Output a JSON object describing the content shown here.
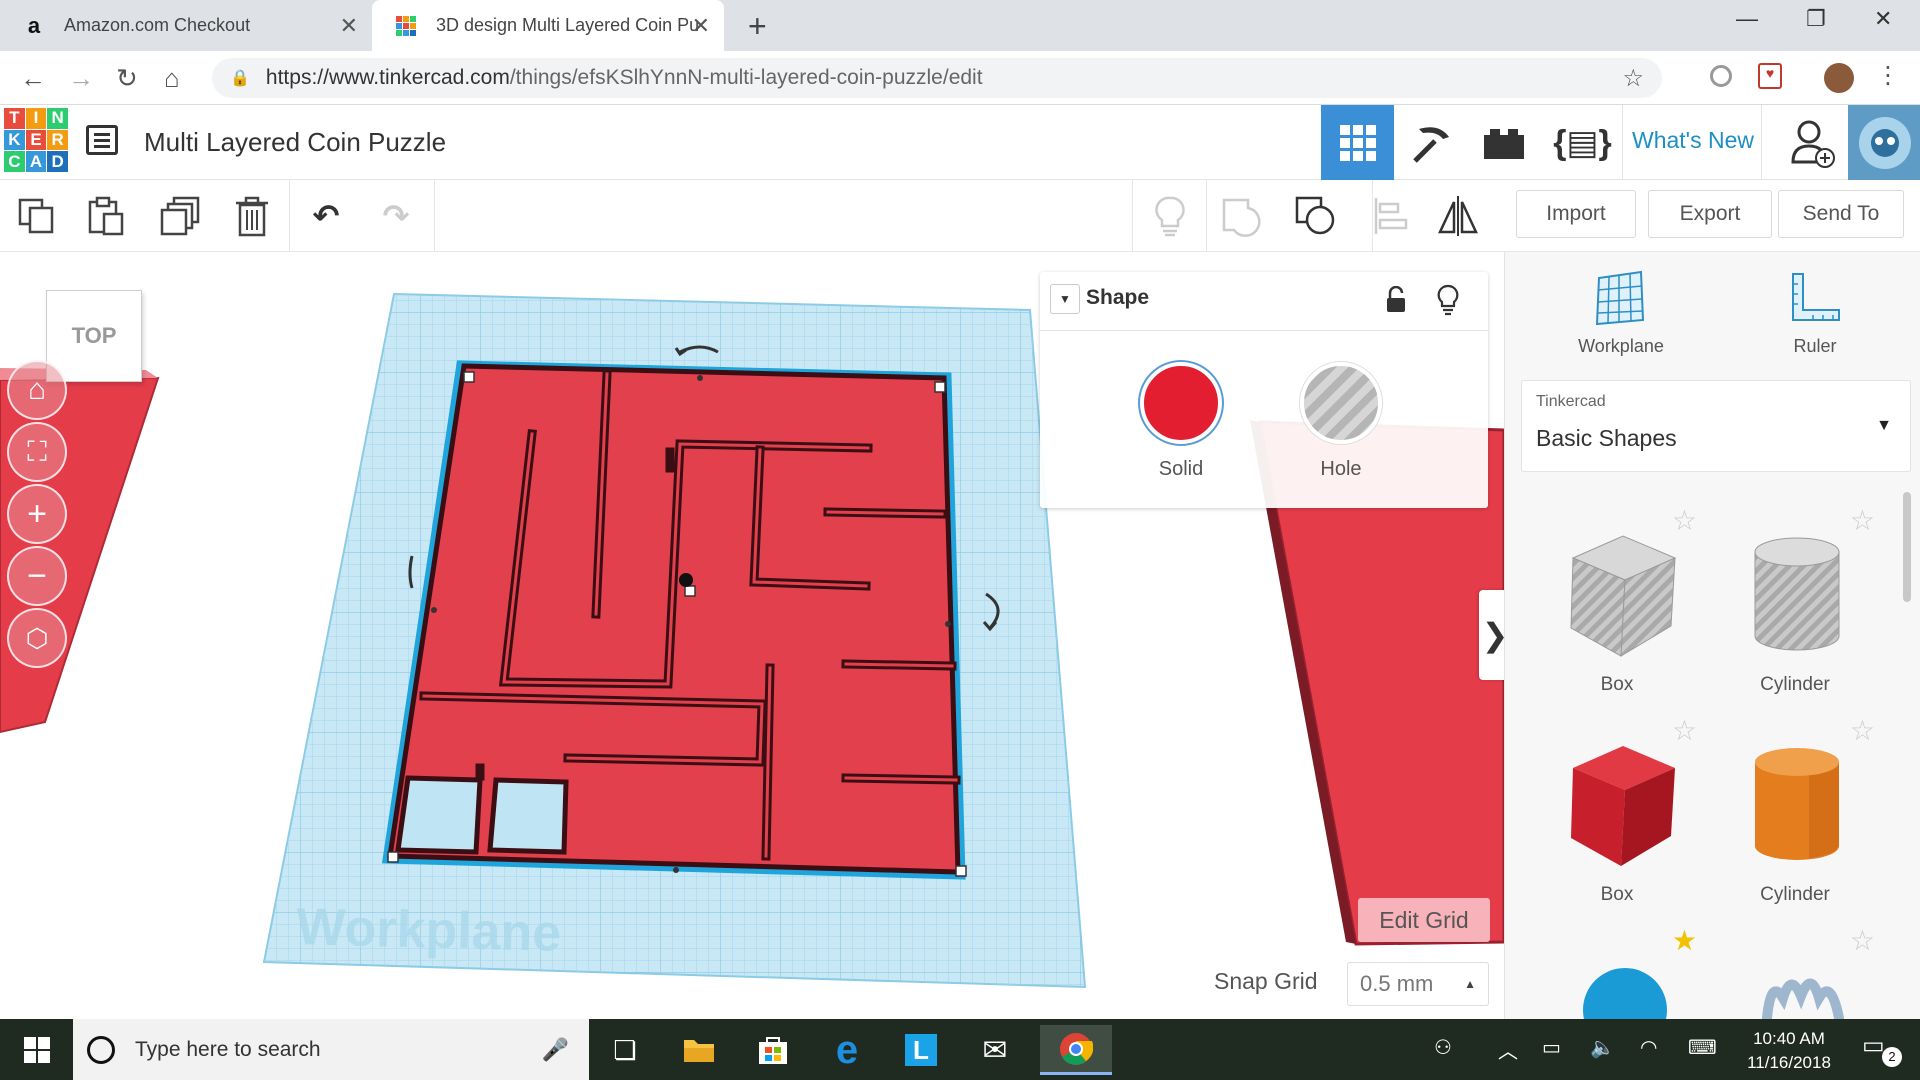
{
  "browser": {
    "tabs": [
      {
        "title": "Amazon.com Checkout",
        "favicon": "amazon-icon",
        "active": false
      },
      {
        "title": "3D design Multi Layered Coin Pu",
        "favicon": "tinkercad-icon",
        "active": true
      }
    ],
    "url_host": "https://www.tinkercad.com",
    "url_path": "/things/efsKSlhYnnN-multi-layered-coin-puzzle/edit"
  },
  "app": {
    "logo_letters": [
      "T",
      "I",
      "N",
      "K",
      "E",
      "R",
      "C",
      "A",
      "D"
    ],
    "logo_colors": [
      "#e74c3c",
      "#f39c12",
      "#2ecc71",
      "#3498db",
      "#e74c3c",
      "#f39c12",
      "#2ecc71",
      "#3498db",
      "#1d6fb8"
    ],
    "design_title": "Multi Layered Coin Puzzle",
    "whats_new": "What's New"
  },
  "toolbar": {
    "import": "Import",
    "export": "Export",
    "send_to": "Send To"
  },
  "workspace": {
    "viewcube_label": "TOP",
    "workplane_label": "Workplane",
    "edit_grid": "Edit Grid",
    "snap_grid_label": "Snap Grid",
    "snap_grid_value": "0.5 mm",
    "colors": {
      "red": "#e53c4a",
      "blue_grid": "#bfe4f3",
      "selection": "#1fa5dc"
    }
  },
  "inspector": {
    "title": "Shape",
    "solid": "Solid",
    "hole": "Hole"
  },
  "panel": {
    "workplane": "Workplane",
    "ruler": "Ruler",
    "library_category": "Tinkercad",
    "library_name": "Basic Shapes",
    "shapes": [
      {
        "label": "Box",
        "kind": "box-hole"
      },
      {
        "label": "Cylinder",
        "kind": "cylinder-hole"
      },
      {
        "label": "Box",
        "kind": "box-solid"
      },
      {
        "label": "Cylinder",
        "kind": "cylinder-solid"
      }
    ]
  },
  "taskbar": {
    "search_placeholder": "Type here to search",
    "time": "10:40 AM",
    "date": "11/16/2018",
    "notifications": "2"
  }
}
